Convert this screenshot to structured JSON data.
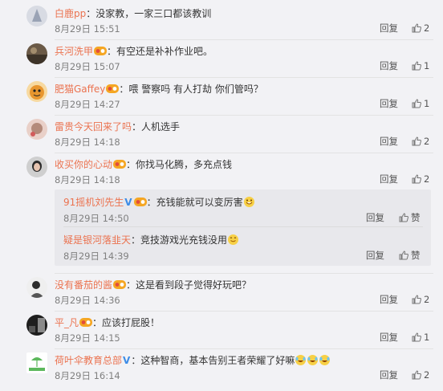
{
  "actions": {
    "reply_label": "回复",
    "like_label": "赞"
  },
  "comments": [
    {
      "user": "白鹿pp",
      "text": "：没家教，一家三口都该教训",
      "time": "8月29日 15:51",
      "likes": "2",
      "has_badge": false
    },
    {
      "user": "兵河洗甲",
      "text": "：有空还是补补作业吧。",
      "time": "8月29日 15:07",
      "likes": "1",
      "has_badge": true
    },
    {
      "user": "肥猫Gaffey",
      "text": "：喂 警察吗 有人打劫 你们管吗？",
      "time": "8月29日 14:27",
      "likes": "1",
      "has_badge": true
    },
    {
      "user": "雷贵今天回来了吗",
      "text": "：人机选手",
      "time": "8月29日 14:18",
      "likes": "2",
      "has_badge": false
    },
    {
      "user": "收买你的心动",
      "text": "：你找马化腾，多充点钱",
      "time": "8月29日 14:18",
      "likes": "2",
      "has_badge": true
    }
  ],
  "replies": [
    {
      "user": "91摇机刘先生",
      "text": "：充钱能就可以变厉害",
      "time": "8月29日 14:50",
      "has_v": true,
      "has_badge": true
    },
    {
      "user": "疑是银河落韭天",
      "text": "：竞技游戏光充钱没用",
      "time": "8月29日 14:39",
      "has_v": false,
      "has_badge": false
    }
  ],
  "comments2": [
    {
      "user": "没有番茄的酱",
      "text": "：这是看到段子觉得好玩吧？",
      "time": "8月29日 14:36",
      "likes": "2",
      "has_badge": true
    },
    {
      "user": "平_凡",
      "text": "：应该打屁股！",
      "time": "8月29日 14:15",
      "likes": "1",
      "has_badge": true
    },
    {
      "user": "荷叶伞教育总部",
      "text": "：这种智商，基本告别王者荣耀了好嘛",
      "time": "8月29日 16:14",
      "likes": "2",
      "has_badge": false,
      "has_v": true
    }
  ],
  "colors": {
    "username": "#eb7350",
    "background": "#f2f2f5",
    "subblock": "#e8e8ec",
    "v_badge": "#3c8ce7"
  }
}
